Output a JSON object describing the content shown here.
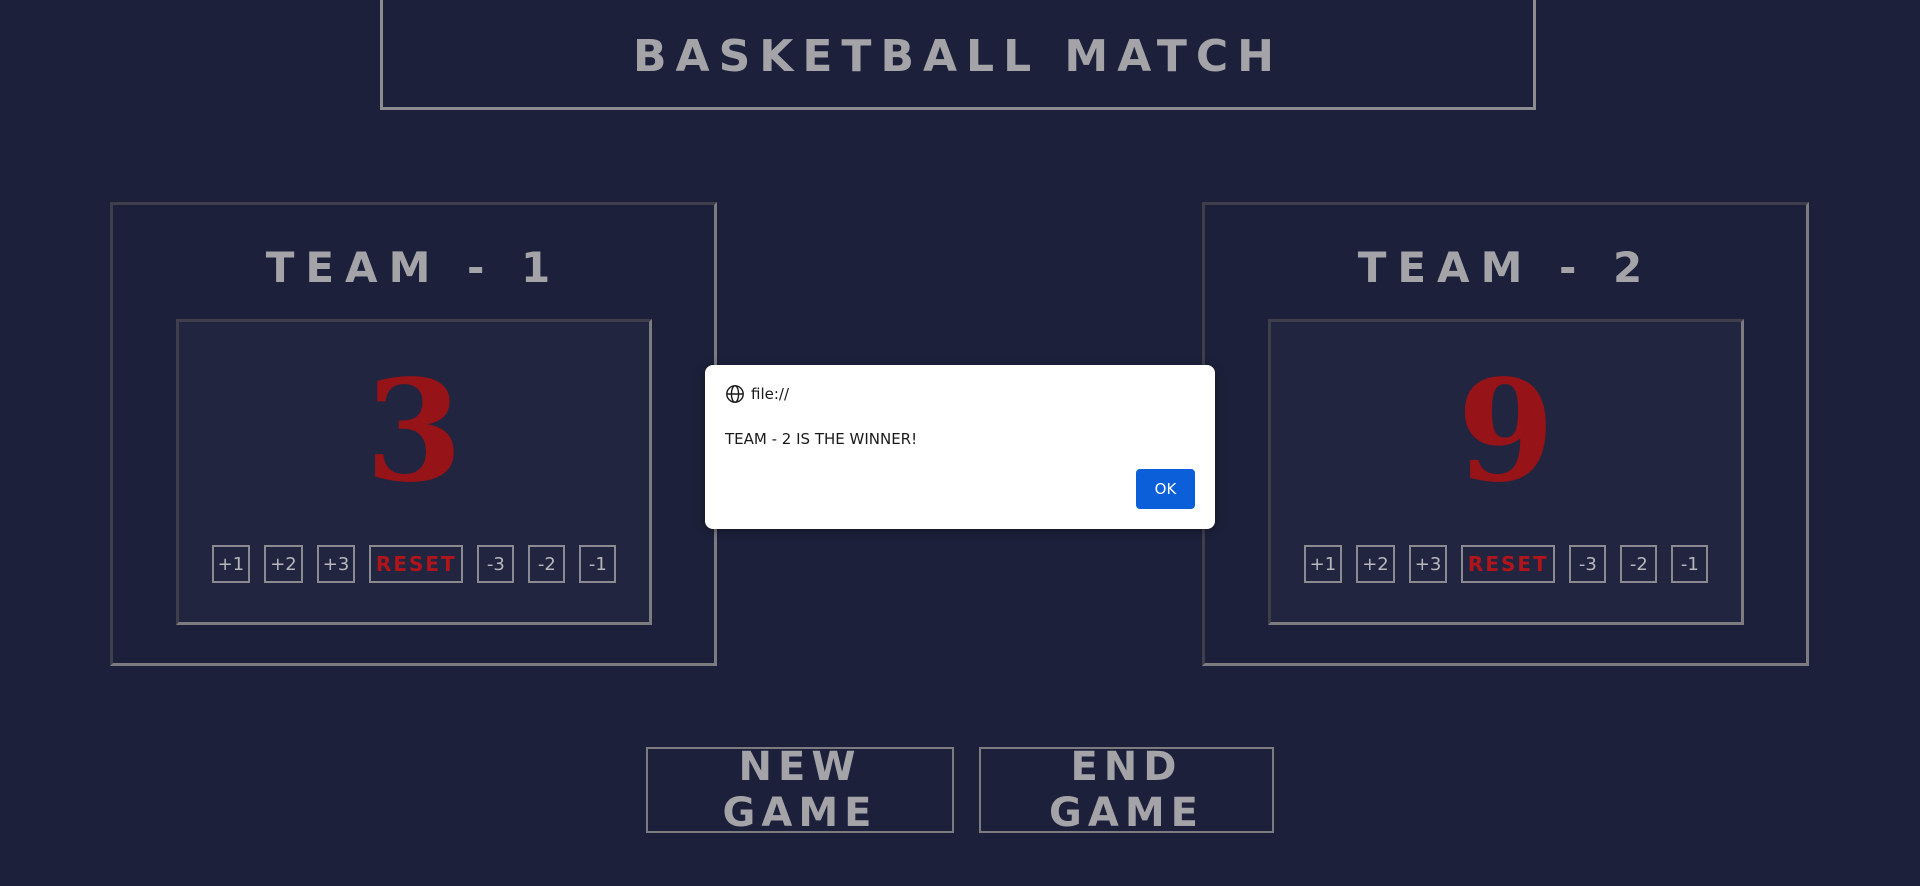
{
  "header": {
    "title": "BASKETBALL MATCH"
  },
  "teams": [
    {
      "name": "TEAM - 1",
      "score": "3",
      "buttons": [
        "+1",
        "+2",
        "+3",
        "RESET",
        "-3",
        "-2",
        "-1"
      ]
    },
    {
      "name": "TEAM - 2",
      "score": "9",
      "buttons": [
        "+1",
        "+2",
        "+3",
        "RESET",
        "-3",
        "-2",
        "-1"
      ]
    }
  ],
  "footer": {
    "new_game_label": "NEW GAME",
    "end_game_label": "END GAME"
  },
  "dialog": {
    "origin": "file://",
    "origin_icon": "globe-icon",
    "message": "TEAM - 2 IS THE WINNER!",
    "ok_label": "OK"
  },
  "colors": {
    "background": "#1c203a",
    "score_red": "#961318",
    "reset_red": "#b0151b",
    "ok_blue": "#0b5fd9"
  }
}
